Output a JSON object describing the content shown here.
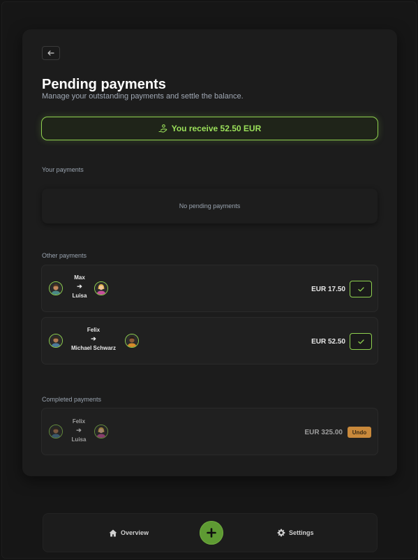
{
  "page": {
    "title": "Pending payments",
    "subtitle": "Manage your outstanding payments and settle the balance."
  },
  "balance": {
    "text": "You receive 52.50 EUR",
    "icon": "hand-coins-icon",
    "accent_color": "#8fd14f"
  },
  "your_payments": {
    "label": "Your payments",
    "empty_text": "No pending payments"
  },
  "other_payments": {
    "label": "Other payments",
    "items": [
      {
        "from": "Max",
        "to": "Luisa",
        "amount": "EUR 17.50",
        "action": "check-icon"
      },
      {
        "from": "Felix",
        "to": "Michael Schwarz",
        "amount": "EUR 52.50",
        "action": "check-icon"
      }
    ]
  },
  "completed_payments": {
    "label": "Completed payments",
    "items": [
      {
        "from": "Felix",
        "to": "Luisa",
        "amount": "EUR 325.00",
        "action_label": "Undo",
        "action_color": "#c9893b"
      }
    ]
  },
  "nav": {
    "overview_label": "Overview",
    "overview_icon": "home-icon",
    "add_icon": "plus-icon",
    "settings_label": "Settings",
    "settings_icon": "gear-icon",
    "add_color": "#5e9a33"
  }
}
